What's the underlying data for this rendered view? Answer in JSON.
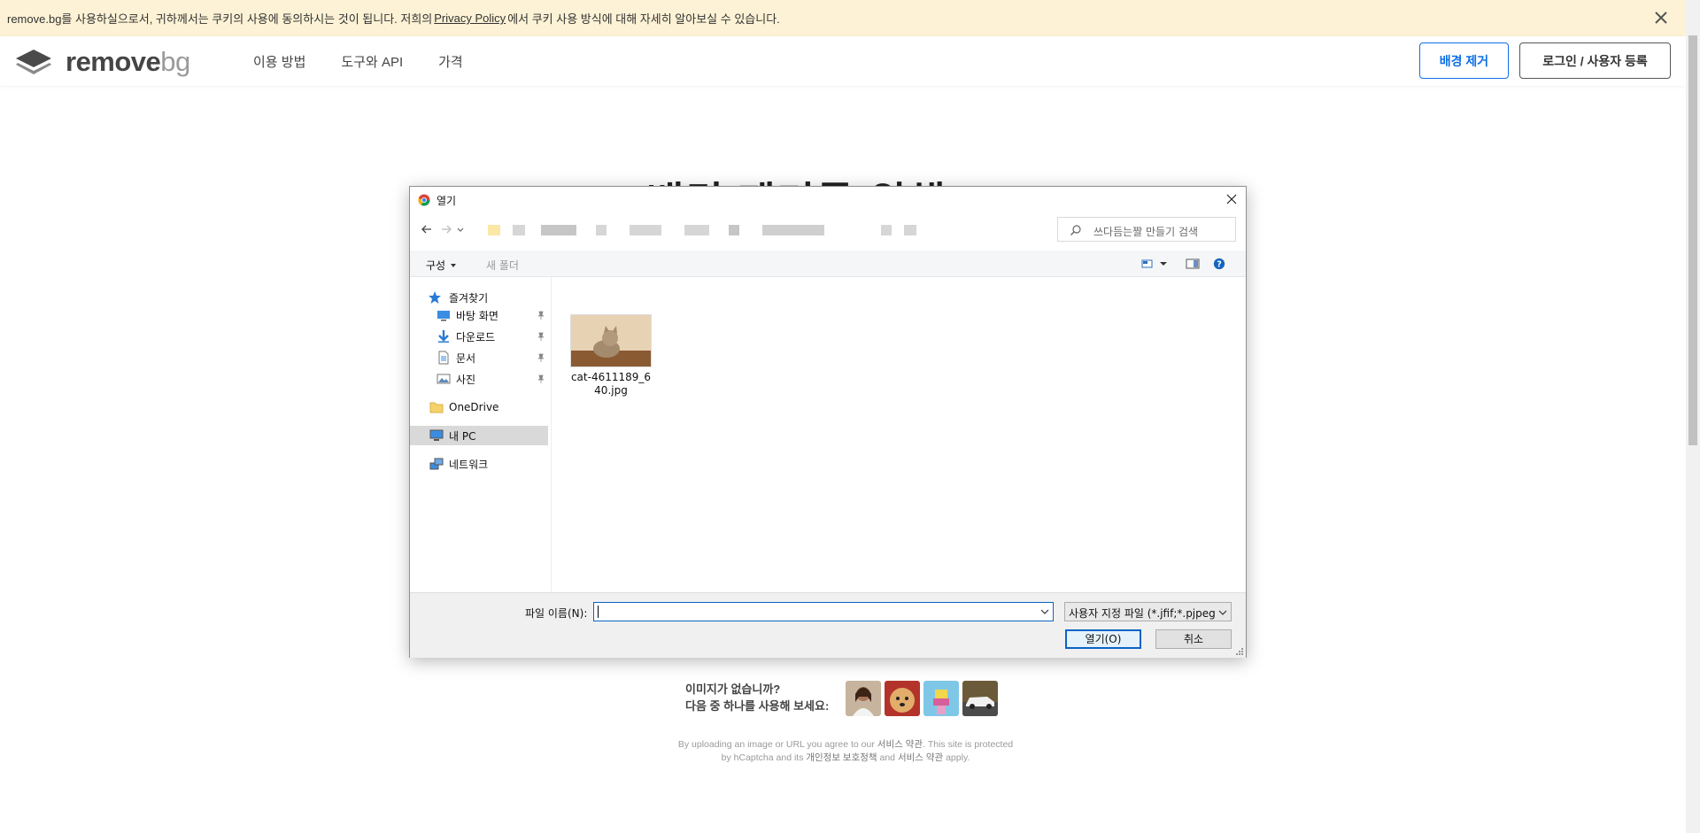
{
  "cookie_bar": {
    "text_before": "remove.bg를 사용하실으로서, 귀하께서는 쿠키의 사용에 동의하시는 것이 됩니다. 저희의",
    "link": "Privacy Policy",
    "text_after": "에서 쿠키 사용 방식에 대해 자세히 알아보실 수 있습니다."
  },
  "header": {
    "logo_main": "remove",
    "logo_bg": "bg",
    "nav": [
      "이용 방법",
      "도구와 API",
      "가격"
    ],
    "remove_bg_button": "배경 제거",
    "login_button": "로그인 / 사용자 등록"
  },
  "hero": {
    "title": "배경 제거를 위해"
  },
  "dialog": {
    "title": "열기",
    "search_placeholder": "쓰다듬는짤 만들기 검색",
    "organize": "구성",
    "new_folder": "새 폴더",
    "nav_items": [
      {
        "label": "즐겨찾기",
        "icon": "star-icon"
      },
      {
        "label": "바탕 화면",
        "icon": "desktop-icon"
      },
      {
        "label": "다운로드",
        "icon": "download-icon"
      },
      {
        "label": "문서",
        "icon": "document-icon"
      },
      {
        "label": "사진",
        "icon": "picture-icon"
      },
      {
        "label": "OneDrive",
        "icon": "folder-icon"
      },
      {
        "label": "내 PC",
        "icon": "pc-icon"
      },
      {
        "label": "네트워크",
        "icon": "network-icon"
      }
    ],
    "files": [
      {
        "name": "cat-4611189_640.jpg"
      }
    ],
    "filename_label": "파일 이름(N):",
    "filename_value": "",
    "file_type": "사용자 지정 파일 (*.jfif;*.pjpeg",
    "open_button": "열기(O)",
    "cancel_button": "취소"
  },
  "samples": {
    "line1": "이미지가 없습니까?",
    "line2": "다음 중 하나를 사용해 보세요:"
  },
  "legal": {
    "line1_a": "By uploading an image or URL you agree to our",
    "line1_link": "서비스 약관",
    "line1_b": ". This site is protected",
    "line2_a": "by hCaptcha and its",
    "line2_link1": "개인정보 보호정책",
    "line2_b": "and",
    "line2_link2": "서비스 약관",
    "line2_c": "apply."
  },
  "colors": {
    "accent": "#0f70e6",
    "cookie_bg": "#fdf2d5",
    "dialog_select": "#d9d9d9"
  }
}
